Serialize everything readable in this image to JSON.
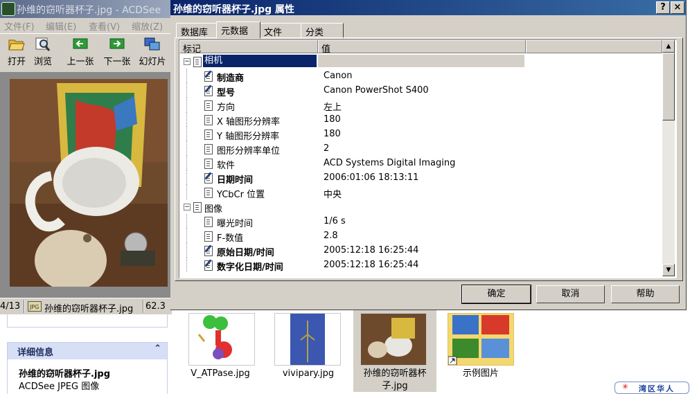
{
  "main_window": {
    "title": "孙维的窃听器杯子.jpg - ACDSee",
    "menu": [
      "文件(F)",
      "编辑(E)",
      "查看(V)",
      "缩放(Z)"
    ],
    "toolbar": [
      "打开",
      "浏览",
      "上一张",
      "下一张",
      "幻灯片"
    ],
    "status": {
      "position": "4/13",
      "filename": "孙维的窃听器杯子.jpg",
      "size": "62.3"
    }
  },
  "explorer": {
    "details_header": "详细信息",
    "details_filename": "孙维的窃听器杯子.jpg",
    "details_type": "ACDSee JPEG 图像",
    "thumbnails": [
      {
        "label": "V_ATPase.jpg"
      },
      {
        "label": "vivipary.jpg"
      },
      {
        "label": "孙维的窃听器杯子.jpg"
      },
      {
        "label": "示例图片"
      }
    ]
  },
  "dialog": {
    "title": "孙维的窃听器杯子.jpg 属性",
    "help_button": "?",
    "close_button": "×",
    "tabs": [
      "数据库",
      "元数据",
      "文件",
      "分类"
    ],
    "active_tab": "元数据",
    "columns": [
      "标记",
      "值"
    ],
    "rows": [
      {
        "label": "相机",
        "value": "",
        "group": true
      },
      {
        "label": "制造商",
        "value": "Canon",
        "bold": true,
        "edit": true
      },
      {
        "label": "型号",
        "value": "Canon PowerShot S400",
        "bold": true,
        "edit": true
      },
      {
        "label": "方向",
        "value": "左上"
      },
      {
        "label": "X 轴图形分辨率",
        "value": "180"
      },
      {
        "label": "Y 轴图形分辨率",
        "value": "180"
      },
      {
        "label": "图形分辨率单位",
        "value": "2"
      },
      {
        "label": "软件",
        "value": "ACD Systems Digital Imaging"
      },
      {
        "label": "日期时间",
        "value": "2006:01:06 18:13:11",
        "bold": true,
        "edit": true
      },
      {
        "label": "YCbCr 位置",
        "value": "中央"
      },
      {
        "label": "图像",
        "value": "",
        "group": true
      },
      {
        "label": "曝光时间",
        "value": "1/6 s"
      },
      {
        "label": "F-数值",
        "value": "2.8"
      },
      {
        "label": "原始日期/时间",
        "value": "2005:12:18 16:25:44",
        "bold": true,
        "edit": true
      },
      {
        "label": "数字化日期/时间",
        "value": "2005:12:18 16:25:44",
        "bold": true,
        "edit": true
      }
    ],
    "buttons": [
      "确定",
      "取消",
      "帮助"
    ]
  },
  "watermark": "湾区华人"
}
